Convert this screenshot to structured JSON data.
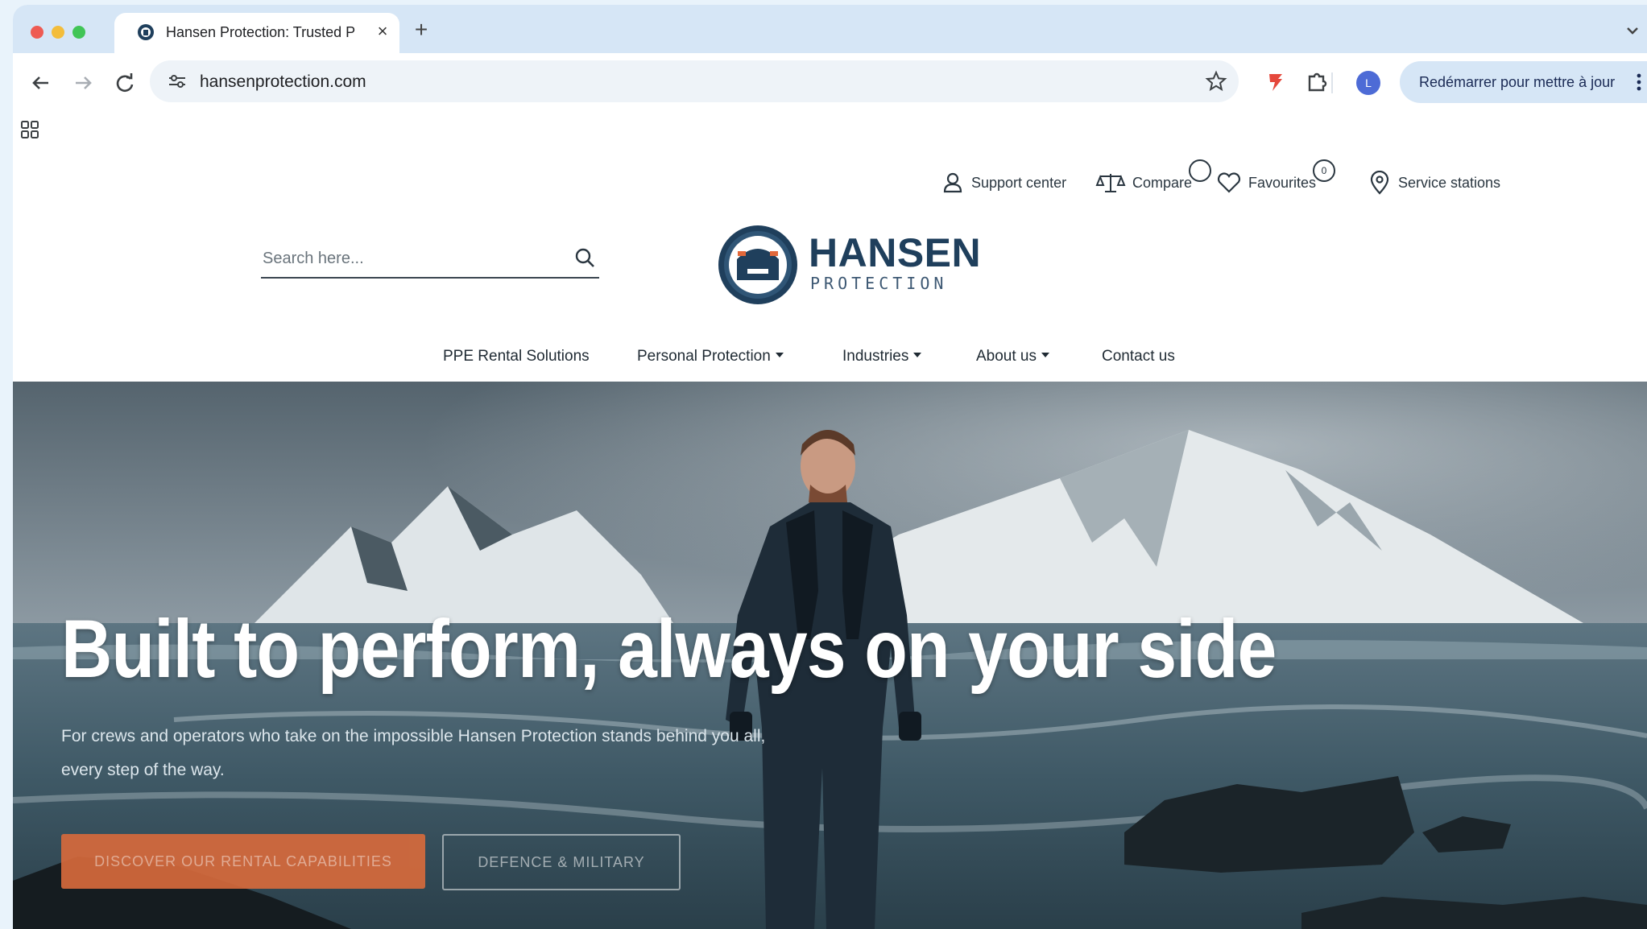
{
  "browser": {
    "tab": {
      "title": "Hansen Protection: Trusted P",
      "close": "×"
    },
    "new_tab": "+",
    "url": "hansenprotection.com",
    "profile_initial": "L",
    "update_button": "Redémarrer pour mettre à jour"
  },
  "header": {
    "utility": {
      "support": "Support center",
      "compare": "Compare",
      "favourites": "Favourites",
      "favourites_count": "0",
      "service": "Service stations"
    },
    "search": {
      "placeholder": "Search here..."
    },
    "logo": {
      "name": "HANSEN",
      "sub": "PROTECTION"
    },
    "nav": {
      "rental": "PPE Rental Solutions",
      "personal": "Personal Protection",
      "industries": "Industries",
      "about": "About us",
      "contact": "Contact us"
    }
  },
  "hero": {
    "title": "Built to perform, always on your side",
    "subtitle": "For crews and operators who take on the impossible Hansen Protection stands behind you all, every step of the way.",
    "primary_cta": "Discover our rental capabilities",
    "secondary_cta": "Defence & military"
  },
  "colors": {
    "brand_navy": "#1f3f5c",
    "cta_orange": "#d66a3c",
    "chrome_blue": "#d6e6f6"
  }
}
